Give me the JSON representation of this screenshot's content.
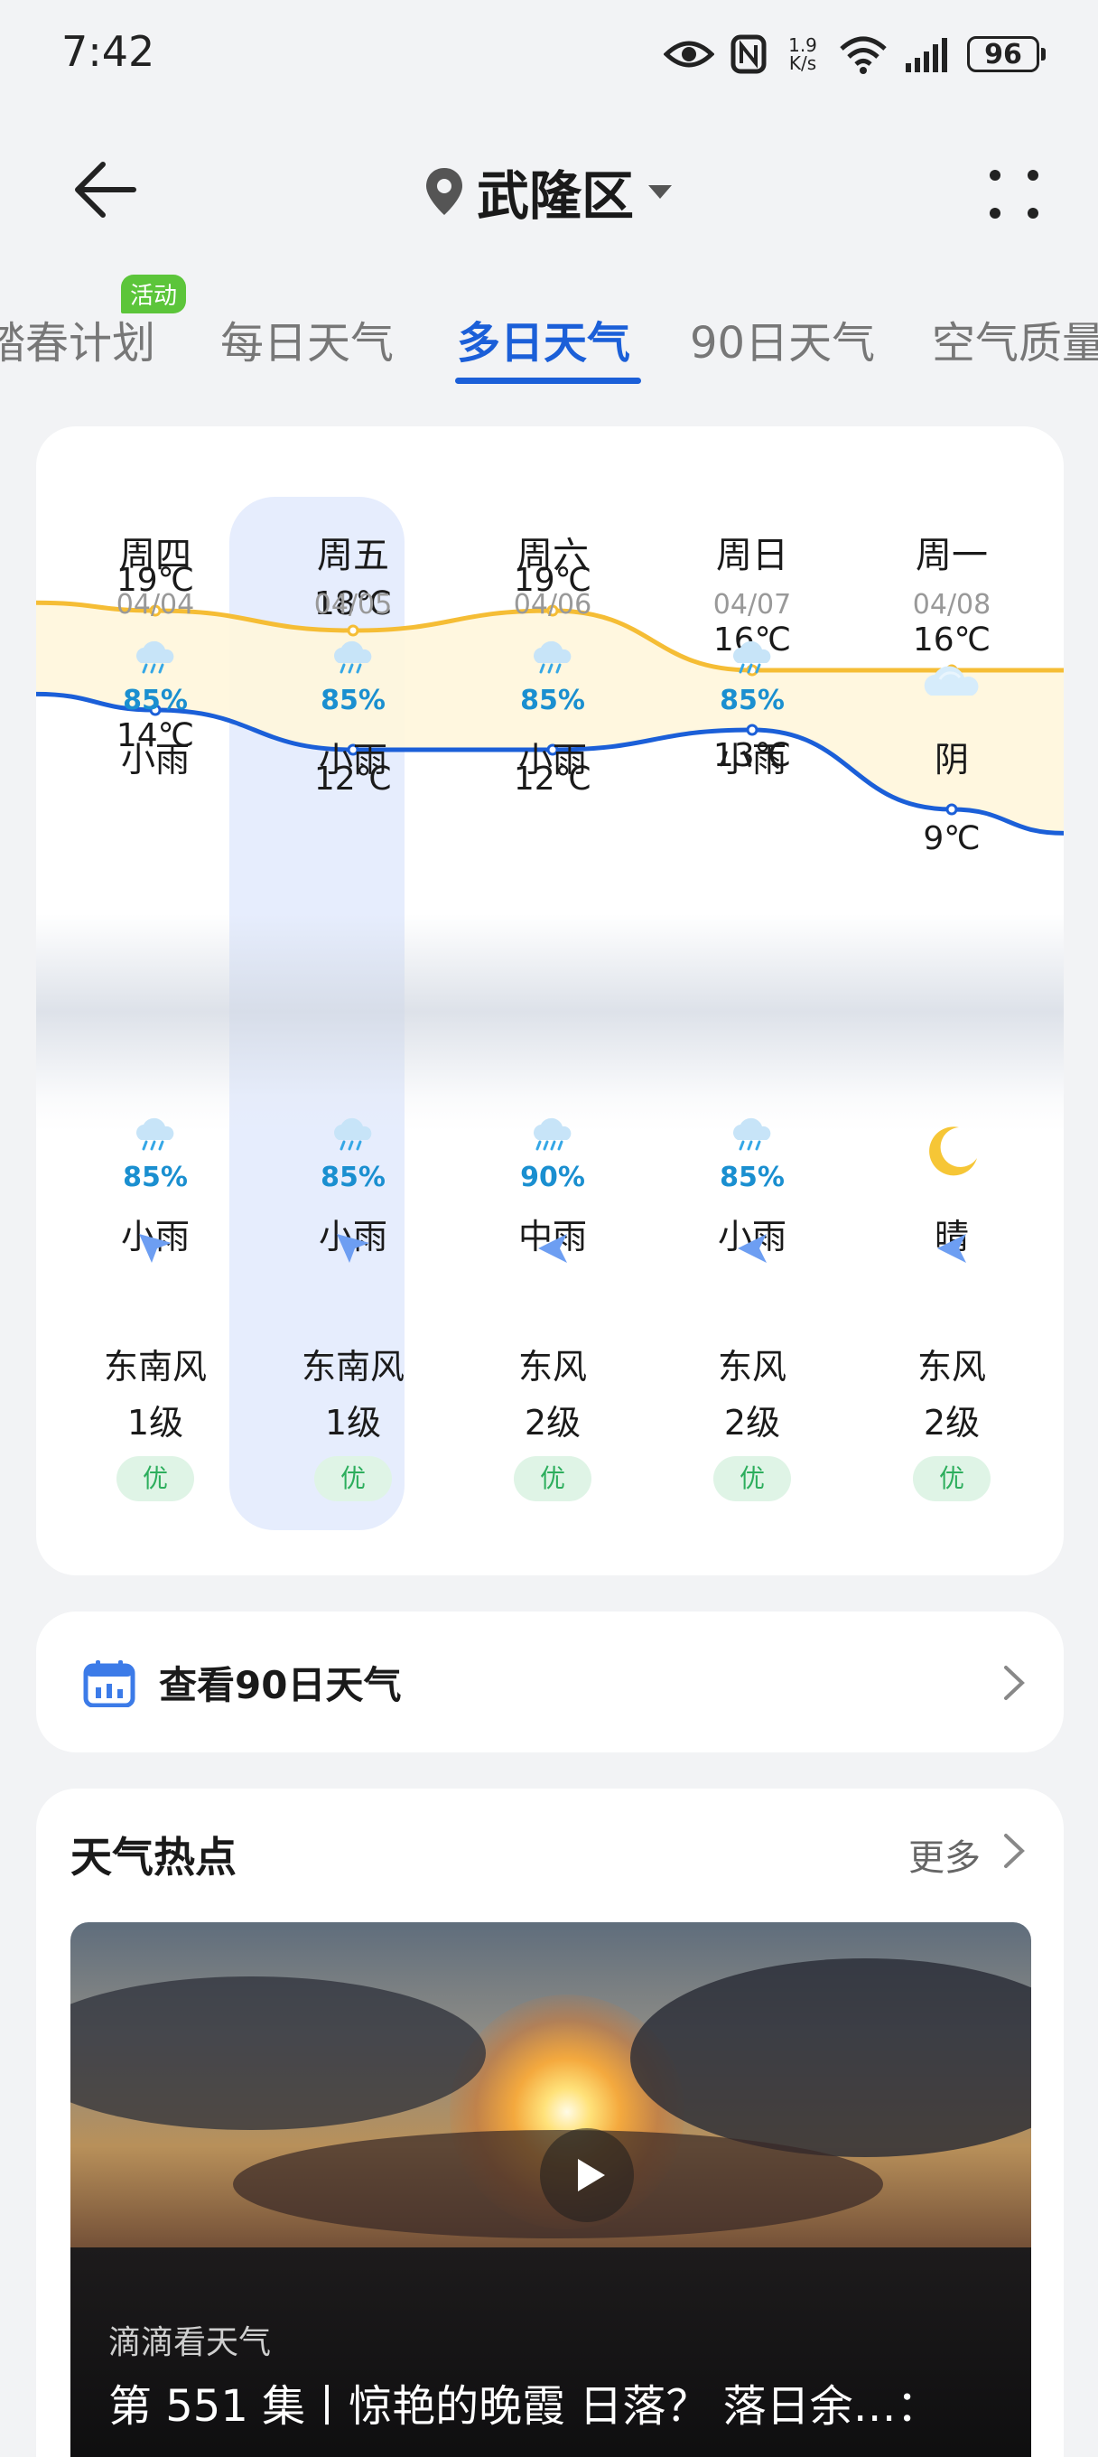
{
  "status": {
    "time": "7:42",
    "net_speed_top": "1.9",
    "net_speed_bottom": "K/s",
    "battery": "96"
  },
  "header": {
    "location": "武隆区"
  },
  "tabs": [
    {
      "label": "踏春计划",
      "badge": "活动"
    },
    {
      "label": "每日天气"
    },
    {
      "label": "多日天气",
      "active": true
    },
    {
      "label": "90日天气"
    },
    {
      "label": "空气质量"
    }
  ],
  "days": [
    {
      "name": "周四",
      "date": "04/04",
      "day_icon": "light-rain",
      "day_pct": "85%",
      "day_text": "小雨",
      "high": "19℃",
      "low": "14℃",
      "night_icon": "light-rain",
      "night_pct": "85%",
      "night_text": "小雨",
      "wind_dir": "东南风",
      "wind_level": "1级",
      "aqi": "优"
    },
    {
      "name": "周五",
      "date": "04/05",
      "day_icon": "light-rain",
      "day_pct": "85%",
      "day_text": "小雨",
      "high": "18℃",
      "low": "12℃",
      "night_icon": "light-rain",
      "night_pct": "85%",
      "night_text": "小雨",
      "wind_dir": "东南风",
      "wind_level": "1级",
      "aqi": "优",
      "selected": true
    },
    {
      "name": "周六",
      "date": "04/06",
      "day_icon": "light-rain",
      "day_pct": "85%",
      "day_text": "小雨",
      "high": "19℃",
      "low": "12℃",
      "night_icon": "moderate-rain",
      "night_pct": "90%",
      "night_text": "中雨",
      "wind_dir": "东风",
      "wind_level": "2级",
      "aqi": "优"
    },
    {
      "name": "周日",
      "date": "04/07",
      "day_icon": "light-rain",
      "day_pct": "85%",
      "day_text": "小雨",
      "high": "16℃",
      "low": "13℃",
      "night_icon": "light-rain",
      "night_pct": "85%",
      "night_text": "小雨",
      "wind_dir": "东风",
      "wind_level": "2级",
      "aqi": "优"
    },
    {
      "name": "周一",
      "date": "04/08",
      "day_icon": "overcast",
      "day_pct": "",
      "day_text": "阴",
      "high": "16℃",
      "low": "9℃",
      "night_icon": "clear-night",
      "night_pct": "",
      "night_text": "晴",
      "wind_dir": "东风",
      "wind_level": "2级",
      "aqi": "优"
    }
  ],
  "chart_data": {
    "type": "line",
    "categories": [
      "周四",
      "周五",
      "周六",
      "周日",
      "周一"
    ],
    "series": [
      {
        "values": [
          19,
          18,
          19,
          16,
          16
        ],
        "color": "#f5bd35"
      },
      {
        "values": [
          14,
          12,
          12,
          13,
          9
        ],
        "color": "#1b5fd8"
      }
    ]
  },
  "row90": {
    "label": "查看90日天气"
  },
  "hot": {
    "title": "天气热点",
    "more": "更多",
    "video_source": "滴滴看天气",
    "video_title": "第 551 集丨惊艳的晚霞 日落？ 落日余…："
  },
  "colors": {
    "accent": "#1b5fd8",
    "rain_pct": "#1a8fd0",
    "aqi_good": "#2dae5d"
  }
}
